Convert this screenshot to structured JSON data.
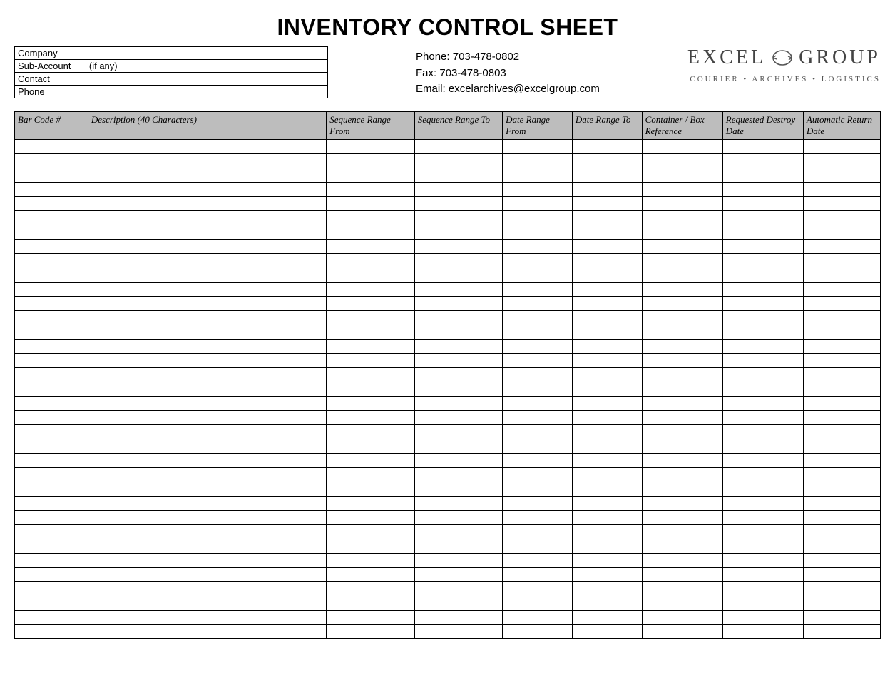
{
  "title": "INVENTORY CONTROL SHEET",
  "infoFields": [
    {
      "label": "Company",
      "value": ""
    },
    {
      "label": "Sub-Account",
      "value": "(if any)"
    },
    {
      "label": "Contact",
      "value": ""
    },
    {
      "label": "Phone",
      "value": ""
    }
  ],
  "contact": {
    "phone": "Phone:  703-478-0802",
    "fax": "Fax:  703-478-0803",
    "email": "Email: excelarchives@excelgroup.com"
  },
  "logo": {
    "left": "EXCEL",
    "right": "GROUP",
    "tagline": "COURIER • ARCHIVES • LOGISTICS"
  },
  "columns": [
    "Bar Code #",
    "Description (40 Characters)",
    "Sequence Range From",
    "Sequence Range To",
    "Date Range From",
    "Date Range To",
    "Container / Box Reference",
    "Requested Destroy Date",
    "Automatic Return Date"
  ],
  "rowCount": 35
}
